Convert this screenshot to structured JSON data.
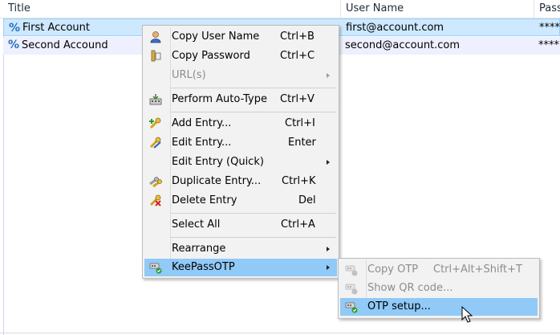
{
  "columns": [
    {
      "label": "Title"
    },
    {
      "label": "User Name"
    },
    {
      "label": "Pass"
    }
  ],
  "rows": [
    {
      "title": "First Account",
      "username": "first@account.com",
      "password": "****"
    },
    {
      "title": "Second Accound",
      "username": "second@account.com",
      "password": "****"
    }
  ],
  "context_menu": {
    "items": [
      {
        "label": "Copy User Name",
        "shortcut": "Ctrl+B",
        "icon": "user-icon"
      },
      {
        "label": "Copy Password",
        "shortcut": "Ctrl+C",
        "icon": "key-icon"
      },
      {
        "label": "URL(s)",
        "shortcut": "",
        "icon": "",
        "disabled": true,
        "submenu": true
      },
      {
        "label": "Perform Auto-Type",
        "shortcut": "Ctrl+V",
        "icon": "autotype-icon"
      },
      {
        "label": "Add Entry...",
        "shortcut": "Ctrl+I",
        "icon": "add-key-icon"
      },
      {
        "label": "Edit Entry...",
        "shortcut": "Enter",
        "icon": "edit-key-icon"
      },
      {
        "label": "Edit Entry (Quick)",
        "shortcut": "",
        "icon": "",
        "submenu": true
      },
      {
        "label": "Duplicate Entry...",
        "shortcut": "Ctrl+K",
        "icon": "duplicate-key-icon"
      },
      {
        "label": "Delete Entry",
        "shortcut": "Del",
        "icon": "delete-key-icon"
      },
      {
        "label": "Select All",
        "shortcut": "Ctrl+A",
        "icon": ""
      },
      {
        "label": "Rearrange",
        "shortcut": "",
        "icon": "",
        "submenu": true
      },
      {
        "label": "KeePassOTP",
        "shortcut": "",
        "icon": "otp-icon",
        "submenu": true,
        "highlighted": true
      }
    ]
  },
  "submenu": {
    "items": [
      {
        "label": "Copy OTP",
        "shortcut": "Ctrl+Alt+Shift+T",
        "disabled": true,
        "icon": "otp-icon"
      },
      {
        "label": "Show QR code...",
        "shortcut": "",
        "disabled": true,
        "icon": "otp-icon"
      },
      {
        "label": "OTP setup...",
        "shortcut": "",
        "highlighted": true,
        "icon": "otp-icon"
      }
    ]
  },
  "colors": {
    "selection": "#cde8ff",
    "menu_highlight": "#91c9f7",
    "menu_bg": "#f2f2f2"
  }
}
